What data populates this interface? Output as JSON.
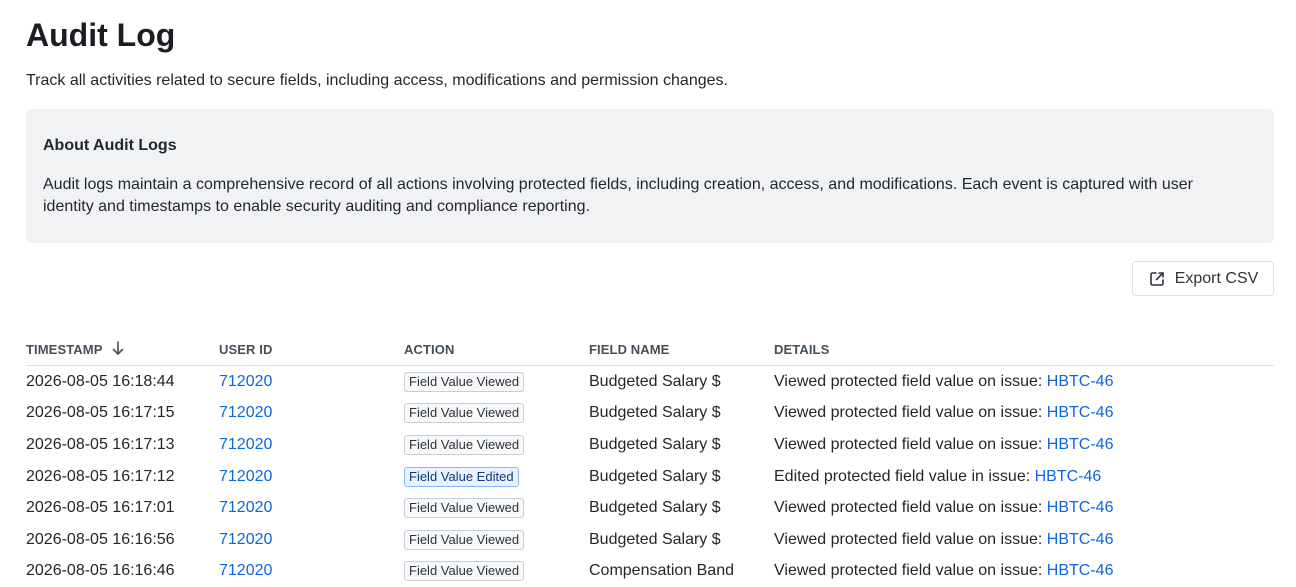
{
  "page": {
    "title": "Audit Log",
    "subtitle": "Track all activities related to secure fields, including access, modifications and permission changes."
  },
  "info_panel": {
    "title": "About Audit Logs",
    "text": "Audit logs maintain a comprehensive record of all actions involving protected fields, including creation, access, and modifications. Each event is captured with user identity and timestamps to enable security auditing and compliance reporting."
  },
  "toolbar": {
    "export_label": "Export CSV",
    "export_icon": "external-link-icon"
  },
  "table": {
    "sort": {
      "column": "timestamp",
      "direction": "descending",
      "icon": "arrow-down-icon"
    },
    "columns": [
      {
        "key": "timestamp",
        "label": "TIMESTAMP"
      },
      {
        "key": "user_id",
        "label": "USER ID"
      },
      {
        "key": "action",
        "label": "ACTION"
      },
      {
        "key": "field_name",
        "label": "FIELD NAME"
      },
      {
        "key": "details",
        "label": "DETAILS"
      }
    ],
    "rows": [
      {
        "timestamp": "2026-08-05 16:18:44",
        "user_id": "712020",
        "action": "Field Value Viewed",
        "action_type": "viewed",
        "field_name": "Budgeted Salary $",
        "details_text": "Viewed protected field value on issue:",
        "issue": "HBTC-46"
      },
      {
        "timestamp": "2026-08-05 16:17:15",
        "user_id": "712020",
        "action": "Field Value Viewed",
        "action_type": "viewed",
        "field_name": "Budgeted Salary $",
        "details_text": "Viewed protected field value on issue:",
        "issue": "HBTC-46"
      },
      {
        "timestamp": "2026-08-05 16:17:13",
        "user_id": "712020",
        "action": "Field Value Viewed",
        "action_type": "viewed",
        "field_name": "Budgeted Salary $",
        "details_text": "Viewed protected field value on issue:",
        "issue": "HBTC-46"
      },
      {
        "timestamp": "2026-08-05 16:17:12",
        "user_id": "712020",
        "action": "Field Value Edited",
        "action_type": "edited",
        "field_name": "Budgeted Salary $",
        "details_text": "Edited protected field value in issue:",
        "issue": "HBTC-46"
      },
      {
        "timestamp": "2026-08-05 16:17:01",
        "user_id": "712020",
        "action": "Field Value Viewed",
        "action_type": "viewed",
        "field_name": "Budgeted Salary $",
        "details_text": "Viewed protected field value on issue:",
        "issue": "HBTC-46"
      },
      {
        "timestamp": "2026-08-05 16:16:56",
        "user_id": "712020",
        "action": "Field Value Viewed",
        "action_type": "viewed",
        "field_name": "Budgeted Salary $",
        "details_text": "Viewed protected field value on issue:",
        "issue": "HBTC-46"
      },
      {
        "timestamp": "2026-08-05 16:16:46",
        "user_id": "712020",
        "action": "Field Value Viewed",
        "action_type": "viewed",
        "field_name": "Compensation Band",
        "details_text": "Viewed protected field value on issue:",
        "issue": "HBTC-46"
      }
    ]
  },
  "colors": {
    "link": "#0c66e4",
    "panel_background": "#f1f2f4",
    "edited_lozenge_background": "#e9f2ff",
    "edited_lozenge_border": "#85b8ff"
  }
}
